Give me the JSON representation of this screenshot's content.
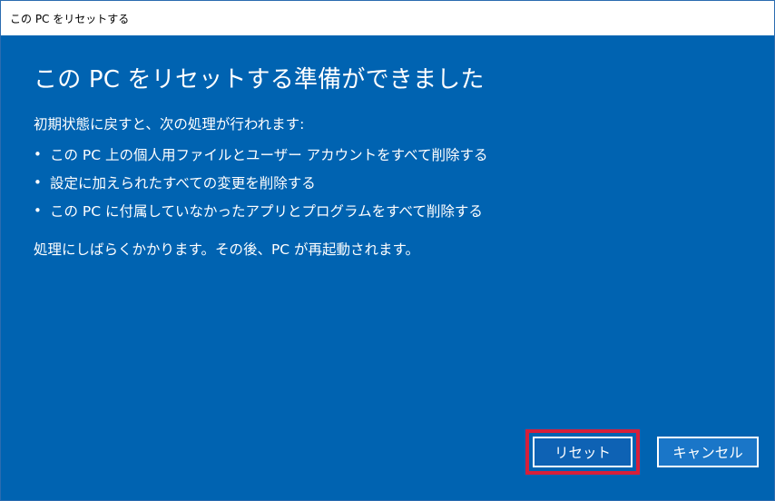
{
  "window": {
    "title": "この PC をリセットする"
  },
  "main": {
    "heading": "この PC をリセットする準備ができました",
    "intro": "初期状態に戻すと、次の処理が行われます:",
    "bullets": [
      "この PC 上の個人用ファイルとユーザー アカウントをすべて削除する",
      "設定に加えられたすべての変更を削除する",
      "この PC に付属していなかったアプリとプログラムをすべて削除する"
    ],
    "bullet_glyph": "•",
    "outro": "処理にしばらくかかります。その後、PC が再起動されます。"
  },
  "buttons": {
    "reset_label": "リセット",
    "cancel_label": "キャンセル"
  },
  "colors": {
    "background": "#0063b1",
    "highlight": "#d61f3a",
    "button": "#1a76c8"
  }
}
